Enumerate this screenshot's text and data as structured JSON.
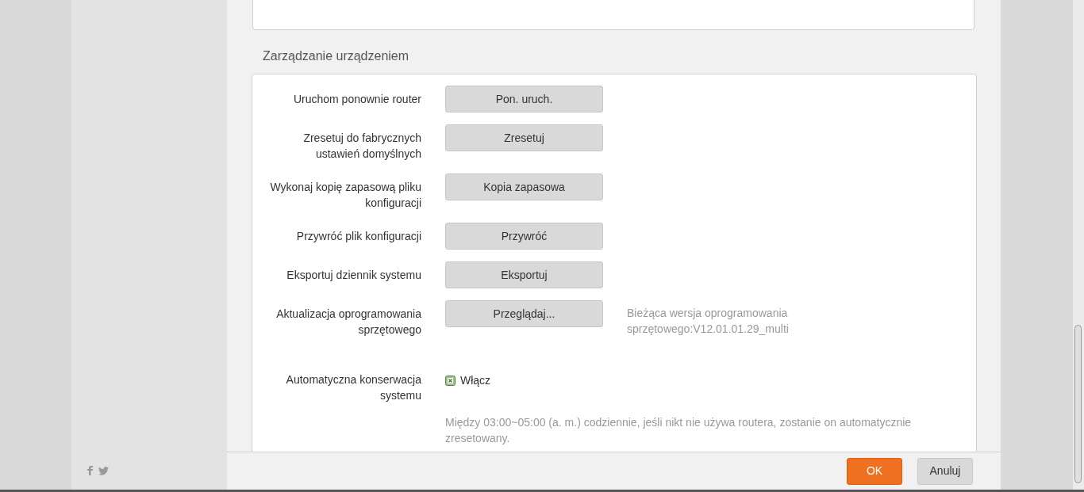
{
  "section_title": "Zarządzanie urządzeniem",
  "rows": [
    {
      "kind": "button",
      "label": "Uruchom ponownie router",
      "button": "Pon. uruch."
    },
    {
      "kind": "button",
      "label": "Zresetuj do fabrycznych ustawień domyślnych",
      "button": "Zresetuj"
    },
    {
      "kind": "button",
      "label": "Wykonaj kopię zapasową pliku konfiguracji",
      "button": "Kopia zapasowa"
    },
    {
      "kind": "button",
      "label": "Przywróć plik konfiguracji",
      "button": "Przywróć"
    },
    {
      "kind": "button",
      "label": "Eksportuj dziennik systemu",
      "button": "Eksportuj"
    },
    {
      "kind": "button",
      "label": "Aktualizacja oprogramowania sprzętowego",
      "button": "Przeglądaj...",
      "note": "Bieżąca wersja oprogramowania sprzętowego:V12.01.01.29_multi"
    },
    {
      "kind": "checkbox",
      "label": "Automatyczna konserwacja systemu",
      "checkbox_label": "Włącz",
      "checked": true,
      "note": "Między 03:00~05:00 (a. m.) codziennie, jeśli nikt nie używa routera, zostanie on automatycznie zresetowany."
    }
  ],
  "footer_buttons": [
    {
      "label": "OK",
      "primary": true
    },
    {
      "label": "Anuluj",
      "primary": false
    }
  ]
}
